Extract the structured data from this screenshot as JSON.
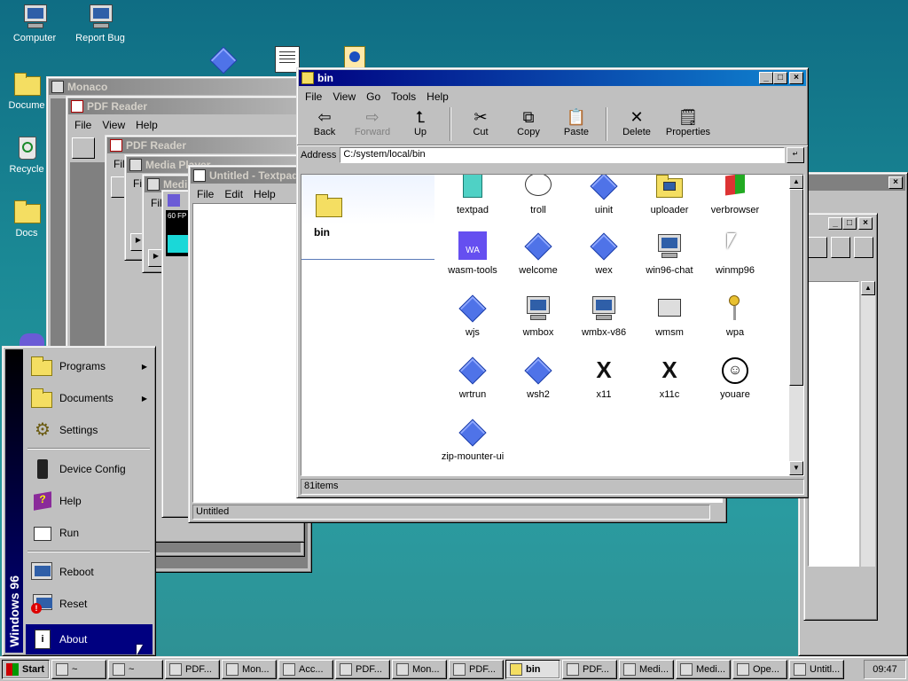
{
  "desktop": {
    "icons": [
      {
        "label": "Computer"
      },
      {
        "label": "Report Bug"
      },
      {
        "label": "Docume"
      },
      {
        "label": "Recycle"
      },
      {
        "label": "Docs"
      }
    ]
  },
  "background_windows": {
    "monaco": {
      "title": "Monaco"
    },
    "pdf_reader_1": {
      "title": "PDF Reader",
      "menu": [
        "File",
        "View",
        "Help"
      ]
    },
    "pdf_reader_2": {
      "title": "PDF Reader",
      "menu": [
        "File"
      ]
    },
    "media_player_1": {
      "title": "Media Player",
      "menu": [
        "File"
      ]
    },
    "media_player_2": {
      "title": "Medi",
      "menu": [
        "File"
      ],
      "fps": "60 FP"
    },
    "textpad": {
      "title": "Untitled - Textpad",
      "menu": [
        "File",
        "Edit",
        "Help"
      ],
      "status": "Untitled"
    }
  },
  "explorer": {
    "title": "bin",
    "menu": [
      "File",
      "View",
      "Go",
      "Tools",
      "Help"
    ],
    "toolbar": [
      {
        "label": "Back",
        "icon": "back-arrow-icon",
        "enabled": true
      },
      {
        "label": "Forward",
        "icon": "forward-arrow-icon",
        "enabled": false
      },
      {
        "label": "Up",
        "icon": "up-folder-icon",
        "enabled": true
      },
      {
        "label": "Cut",
        "icon": "scissors-icon",
        "enabled": true
      },
      {
        "label": "Copy",
        "icon": "copy-icon",
        "enabled": true
      },
      {
        "label": "Paste",
        "icon": "paste-icon",
        "enabled": true
      },
      {
        "label": "Delete",
        "icon": "delete-x-icon",
        "enabled": true
      },
      {
        "label": "Properties",
        "icon": "properties-icon",
        "enabled": true
      }
    ],
    "address_label": "Address",
    "address_value": "C:/system/local/bin",
    "side_title": "bin",
    "items": [
      {
        "label": "textpad",
        "icon": "notepad-icon"
      },
      {
        "label": "troll",
        "icon": "trollface-icon"
      },
      {
        "label": "uinit",
        "icon": "diamond-icon"
      },
      {
        "label": "uploader",
        "icon": "network-folder-icon"
      },
      {
        "label": "verbrowser",
        "icon": "windows-flag-icon"
      },
      {
        "label": "wasm-tools",
        "icon": "wasm-icon",
        "badge": "WA"
      },
      {
        "label": "welcome",
        "icon": "diamond-icon"
      },
      {
        "label": "wex",
        "icon": "diamond-icon"
      },
      {
        "label": "win96-chat",
        "icon": "chat-computer-icon"
      },
      {
        "label": "winmp96",
        "icon": "cursor-icon"
      },
      {
        "label": "wjs",
        "icon": "diamond-icon"
      },
      {
        "label": "wmbox",
        "icon": "x86-computer-icon"
      },
      {
        "label": "wmbx-v86",
        "icon": "x86-computer-icon"
      },
      {
        "label": "wmsm",
        "icon": "windows-stack-icon"
      },
      {
        "label": "wpa",
        "icon": "keys-icon"
      },
      {
        "label": "wrtrun",
        "icon": "diamond-icon"
      },
      {
        "label": "wsh2",
        "icon": "diamond-icon"
      },
      {
        "label": "x11",
        "icon": "x11-icon"
      },
      {
        "label": "x11c",
        "icon": "x11-icon"
      },
      {
        "label": "youare",
        "icon": "smiley-icon"
      },
      {
        "label": "zip-mounter-ui",
        "icon": "diamond-icon"
      }
    ],
    "status": "81items"
  },
  "start_menu": {
    "brand": "Windows 96",
    "items": [
      {
        "label": "Programs",
        "submenu": true
      },
      {
        "label": "Documents",
        "submenu": true
      },
      {
        "label": "Settings",
        "submenu": false
      },
      {
        "label": "Device Config",
        "submenu": false
      },
      {
        "label": "Help",
        "submenu": false
      },
      {
        "label": "Run",
        "submenu": false
      },
      {
        "label": "Reboot",
        "submenu": false
      },
      {
        "label": "Reset",
        "submenu": false
      },
      {
        "label": "About",
        "submenu": false
      }
    ]
  },
  "taskbar": {
    "start_label": "Start",
    "tasks": [
      {
        "label": "~"
      },
      {
        "label": "~"
      },
      {
        "label": "PDF..."
      },
      {
        "label": "Mon..."
      },
      {
        "label": "Acc..."
      },
      {
        "label": "PDF..."
      },
      {
        "label": "Mon..."
      },
      {
        "label": "PDF..."
      },
      {
        "label": "bin",
        "active": true
      },
      {
        "label": "PDF..."
      },
      {
        "label": "Medi..."
      },
      {
        "label": "Medi..."
      },
      {
        "label": "Ope..."
      },
      {
        "label": "Untitl..."
      }
    ],
    "clock": "09:47"
  },
  "colors": {
    "active_title": "#000080",
    "inactive_title": "#808080",
    "window_face": "#c0c0c0",
    "desktop": "#1b8a96"
  }
}
